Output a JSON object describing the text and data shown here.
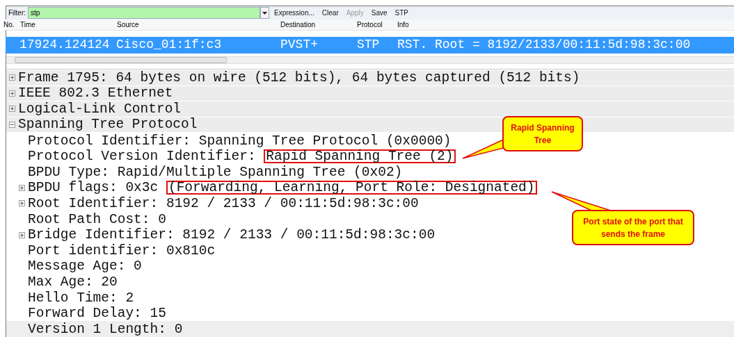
{
  "filter_bar": {
    "label": "Filter:",
    "value": "stp",
    "buttons": [
      {
        "label": "Expression...",
        "disabled": false
      },
      {
        "label": "Clear",
        "disabled": false
      },
      {
        "label": "Apply",
        "disabled": true
      },
      {
        "label": "Save",
        "disabled": false
      },
      {
        "label": "STP",
        "disabled": false
      }
    ]
  },
  "packet_list": {
    "columns": [
      "No.",
      "Time",
      "Source",
      "Destination",
      "Protocol",
      "Info"
    ],
    "rows": [
      {
        "selected": true,
        "cells": [
          "",
          "17924.124124",
          "Cisco_01:1f:c3",
          "PVST+",
          "STP",
          "RST. Root = 8192/2133/00:11:5d:98:3c:00"
        ]
      }
    ]
  },
  "details": [
    {
      "text": "Frame 1795: 64 bytes on wire (512 bits), 64 bytes captured (512 bits)",
      "expanded": false
    },
    {
      "text": "IEEE 802.3 Ethernet",
      "expanded": false
    },
    {
      "text": "Logical-Link Control",
      "expanded": false
    },
    {
      "text": "Spanning Tree Protocol",
      "expanded": true,
      "children": [
        {
          "text": "Protocol Identifier: Spanning Tree Protocol (0x0000)"
        },
        {
          "text": "Protocol Version Identifier: ",
          "boxed": "Rapid Spanning Tree (2)"
        },
        {
          "text": "BPDU Type: Rapid/Multiple Spanning Tree (0x02)"
        },
        {
          "text": "BPDU flags: 0x3c ",
          "boxed": "(Forwarding, Learning, Port Role: Designated)",
          "expanded": false
        },
        {
          "text": "Root Identifier: 8192 / 2133 / 00:11:5d:98:3c:00",
          "expanded": false
        },
        {
          "text": "Root Path Cost: 0"
        },
        {
          "text": "Bridge Identifier: 8192 / 2133 / 00:11:5d:98:3c:00",
          "expanded": false
        },
        {
          "text": "Port identifier: 0x810c"
        },
        {
          "text": "Message Age: 0"
        },
        {
          "text": "Max Age: 20"
        },
        {
          "text": "Hello Time: 2"
        },
        {
          "text": "Forward Delay: 15"
        },
        {
          "text": "Version 1 Length: 0",
          "selected": true
        }
      ]
    }
  ],
  "callouts": [
    {
      "text": "Rapid Spanning Tree"
    },
    {
      "text": "Port state of the port that sends the frame"
    }
  ]
}
